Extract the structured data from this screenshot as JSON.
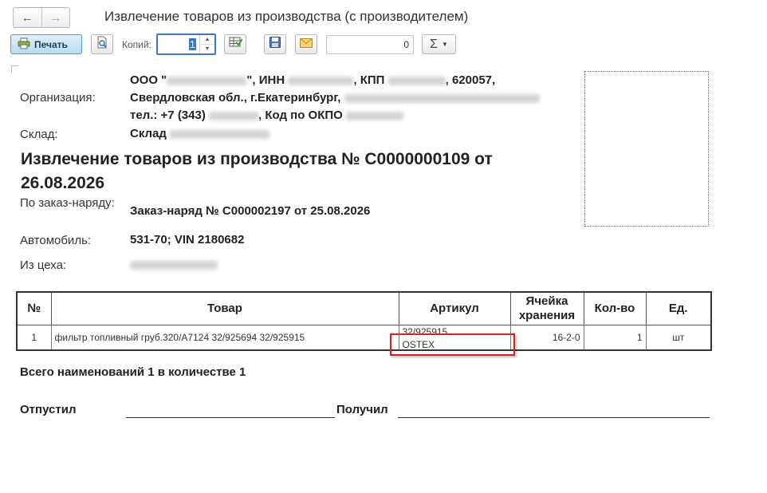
{
  "window": {
    "back_glyph": "←",
    "forward_glyph": "→",
    "title": "Извлечение товаров из производства (с производителем)"
  },
  "toolbar": {
    "print_label": "Печать",
    "copies_label": "Копий:",
    "copies_value": "1",
    "sum_value": "0",
    "sigma_glyph": "Σ",
    "icons": [
      "printer-icon",
      "preview-icon",
      "fill-table-icon",
      "save-icon",
      "email-icon",
      "sigma-icon"
    ]
  },
  "document": {
    "org_label": "Организация:",
    "org_line1_a": "ООО \"",
    "org_line1_b": "\", ИНН",
    "org_line1_c": ", КПП",
    "org_line1_d": ", 620057,",
    "org_line2": "Свердловская обл., г.Екатеринбург,",
    "org_line3_a": "тел.: +7 (343)",
    "org_line3_b": ", Код по ОКПО",
    "warehouse_label": "Склад:",
    "warehouse_value": "Склад",
    "title": "Извлечение товаров из производства № С0000000109 от 26.08.2026",
    "order_label": "По заказ-наряду:",
    "order_value": "Заказ-наряд № С000002197  от 25.08.2026",
    "car_label": "Автомобиль:",
    "car_value": "531-70; VIN 2180682",
    "shop_label": "Из цеха:"
  },
  "table": {
    "headers": [
      "№",
      "Товар",
      "Артикул",
      "Ячейка хранения",
      "Кол-во",
      "Ед."
    ],
    "rows": [
      {
        "num": "1",
        "product": "фильтр топливный груб.320/А7124 32/925694 32/925915",
        "article": "32/925915",
        "manufacturer": "OSTEX",
        "cell": "16-2-0",
        "qty": "1",
        "unit": "шт"
      }
    ]
  },
  "footer": {
    "total": "Всего наименований 1 в количестве 1",
    "released_label": "Отпустил",
    "received_label": "Получил"
  },
  "colors": {
    "accent": "#3b78c4",
    "print_button": "#b8dcf2",
    "highlight": "#d7221f"
  }
}
